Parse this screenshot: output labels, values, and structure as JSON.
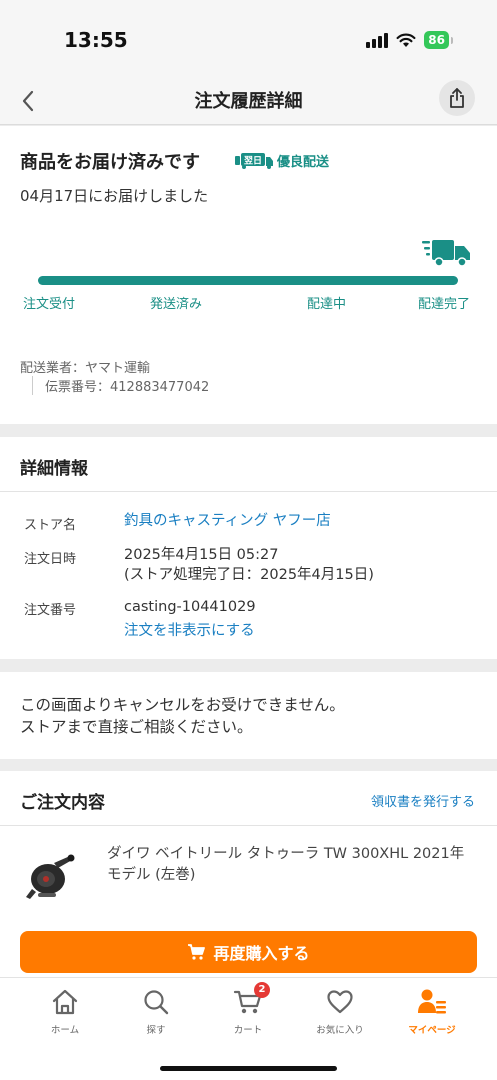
{
  "status_bar": {
    "time": "13:55",
    "battery": "86"
  },
  "nav": {
    "title": "注文履歴詳細"
  },
  "delivery": {
    "title": "商品をお届け済みです",
    "badge_icon_text": "翌日",
    "badge": "優良配送",
    "date_text": "04月17日にお届けしました",
    "progress": 1.0,
    "steps": [
      "注文受付",
      "発送済み",
      "配達中",
      "配達完了"
    ],
    "carrier": "配送業者：ヤマト運輸",
    "tracking": "伝票番号：412883477042"
  },
  "detail": {
    "header": "詳細情報",
    "store_label": "ストア名",
    "store_name": "釣具のキャスティング ヤフー店",
    "date_label": "注文日時",
    "order_date": "2025年4月15日 05:27",
    "processed_date": "(ストア処理完了日：2025年4月15日)",
    "number_label": "注文番号",
    "order_number": "casting-10441029",
    "hide_link": "注文を非表示にする"
  },
  "cancel_notice": {
    "line1": "この画面よりキャンセルをお受けできません。",
    "line2": "ストアまで直接ご相談ください。"
  },
  "order": {
    "header": "ご注文内容",
    "receipt_link": "領収書を発行する",
    "product_name": "ダイワ ベイトリール タトゥーラ TW 300XHL 2021年モデル (左巻)",
    "rebuy_button": "再度購入する"
  },
  "tab_bar": {
    "items": [
      {
        "label": "ホーム",
        "icon": "home-icon"
      },
      {
        "label": "探す",
        "icon": "search-icon"
      },
      {
        "label": "カート",
        "icon": "cart-icon"
      },
      {
        "label": "お気に入り",
        "icon": "heart-icon"
      },
      {
        "label": "マイページ",
        "icon": "mypage-icon"
      }
    ],
    "cart_count": "2",
    "active_color": "#ff7a00"
  },
  "colors": {
    "accent_teal": "#1a8f86",
    "link_blue": "#1a7fc2",
    "primary_orange": "#ff7a00"
  }
}
